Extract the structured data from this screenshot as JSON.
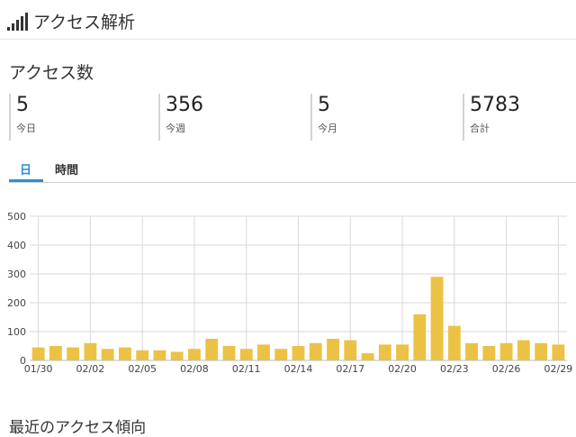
{
  "header": {
    "title": "アクセス解析",
    "icon": "signal-bars-icon"
  },
  "section": {
    "title": "アクセス数"
  },
  "stats": [
    {
      "value": "5",
      "label": "今日"
    },
    {
      "value": "356",
      "label": "今週"
    },
    {
      "value": "5",
      "label": "今月"
    },
    {
      "value": "5783",
      "label": "合計"
    }
  ],
  "tabs": [
    {
      "label": "日",
      "active": true
    },
    {
      "label": "時間",
      "active": false
    }
  ],
  "colors": {
    "bar": "#ecc246",
    "accent": "#2b8fd1",
    "grid": "#d9d9d9"
  },
  "chart_data": {
    "type": "bar",
    "ylim": [
      0,
      500
    ],
    "yticks": [
      0,
      100,
      200,
      300,
      400,
      500
    ],
    "grid": true,
    "categories": [
      "01/30",
      "01/31",
      "02/01",
      "02/02",
      "02/03",
      "02/04",
      "02/05",
      "02/06",
      "02/07",
      "02/08",
      "02/09",
      "02/10",
      "02/11",
      "02/12",
      "02/13",
      "02/14",
      "02/15",
      "02/16",
      "02/17",
      "02/18",
      "02/19",
      "02/20",
      "02/21",
      "02/22",
      "02/23",
      "02/24",
      "02/25",
      "02/26",
      "02/27",
      "02/28",
      "02/29"
    ],
    "xtick_labels": [
      "01/30",
      "02/02",
      "02/05",
      "02/08",
      "02/11",
      "02/14",
      "02/17",
      "02/20",
      "02/23",
      "02/26",
      "02/29"
    ],
    "values": [
      45,
      50,
      45,
      60,
      40,
      45,
      35,
      35,
      30,
      40,
      75,
      50,
      40,
      55,
      40,
      50,
      60,
      75,
      70,
      25,
      55,
      55,
      160,
      290,
      120,
      60,
      50,
      60,
      70,
      60,
      55
    ]
  },
  "footer": {
    "title": "最近のアクセス傾向"
  }
}
